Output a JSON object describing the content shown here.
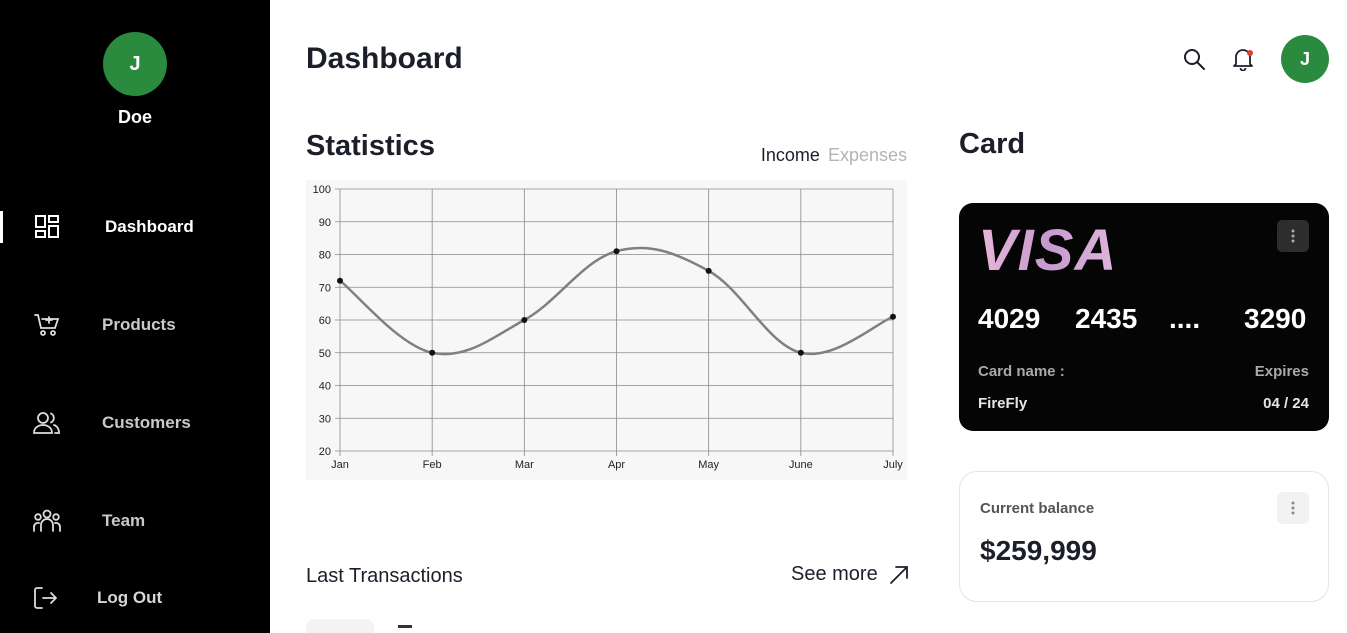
{
  "sidebar": {
    "avatar_initial": "J",
    "user_name": "Doe",
    "items": [
      {
        "label": "Dashboard",
        "icon": "dashboard-icon",
        "active": true
      },
      {
        "label": "Products",
        "icon": "cart-icon",
        "active": false
      },
      {
        "label": "Customers",
        "icon": "users-icon",
        "active": false
      },
      {
        "label": "Team",
        "icon": "team-icon",
        "active": false
      },
      {
        "label": "Log Out",
        "icon": "logout-icon",
        "active": false
      }
    ]
  },
  "header": {
    "title": "Dashboard",
    "avatar_initial": "J",
    "icons": [
      "search-icon",
      "bell-icon"
    ]
  },
  "statistics": {
    "title": "Statistics",
    "legend_income": "Income",
    "legend_expenses": "Expenses"
  },
  "chart_data": {
    "type": "line",
    "categories": [
      "Jan",
      "Feb",
      "Mar",
      "Apr",
      "May",
      "June",
      "July"
    ],
    "series": [
      {
        "values": [
          72,
          50,
          60,
          81,
          75,
          50,
          61
        ]
      }
    ],
    "ylim": [
      20,
      100
    ],
    "yticks": [
      100,
      90,
      80,
      70,
      60,
      50,
      40,
      30,
      20
    ],
    "grid": true
  },
  "transactions": {
    "title": "Last Transactions",
    "see_more": "See more"
  },
  "card": {
    "title": "Card",
    "brand": "VISA",
    "numbers": [
      "4029",
      "2435",
      "....",
      "3290"
    ],
    "name_label": "Card name :",
    "name_value": "FireFly",
    "expires_label": "Expires",
    "expires_value": "04 / 24"
  },
  "balance": {
    "label": "Current balance",
    "value": "$259,999"
  },
  "colors": {
    "sidebar_bg": "#000000",
    "avatar_green": "#2a8a3e",
    "line": "#808080",
    "notif_dot": "#e23a3a"
  }
}
